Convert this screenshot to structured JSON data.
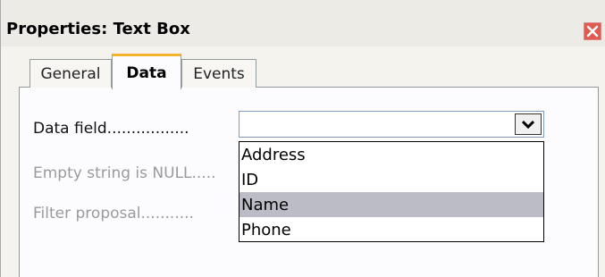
{
  "window": {
    "title": "Properties: Text Box"
  },
  "tabs": [
    {
      "label": "General"
    },
    {
      "label": "Data"
    },
    {
      "label": "Events"
    }
  ],
  "fields": {
    "data_field_label": "Data field.................",
    "empty_string_label": "Empty string is NULL.....",
    "filter_label": "Filter proposal..........."
  },
  "dropdown": {
    "options": [
      "Address",
      "ID",
      "Name",
      "Phone"
    ],
    "highlighted": "Name"
  },
  "colors": {
    "active_tab_accent": "#f3b32e",
    "close_button": "#e05a4f",
    "highlight": "#bcbcc7"
  },
  "icons": {
    "close": "close-icon",
    "dropdown": "chevron-down-icon"
  }
}
